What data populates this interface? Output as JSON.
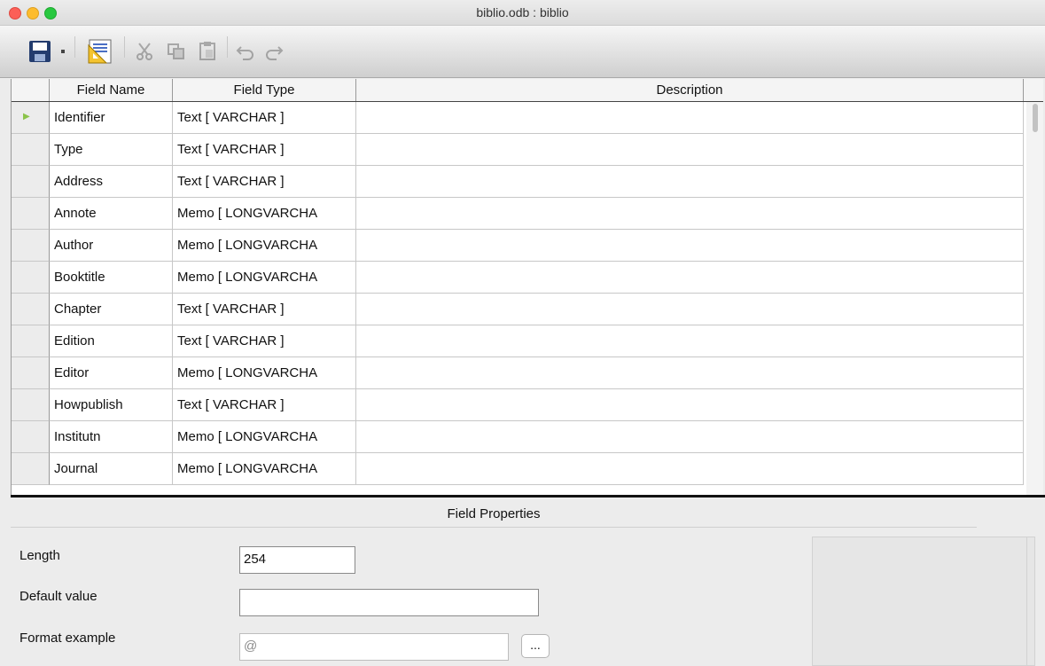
{
  "window": {
    "title": "biblio.odb : biblio"
  },
  "toolbar": {
    "buttons": [
      "save-icon",
      "dropdown-arrow-icon",
      "table-design-icon",
      "cut-icon",
      "copy-icon",
      "paste-icon",
      "undo-icon",
      "redo-icon"
    ]
  },
  "table": {
    "headers": [
      "Field Name",
      "Field Type",
      "Description"
    ],
    "rows": [
      {
        "name": "Identifier",
        "type": "Text [ VARCHAR ]",
        "description": ""
      },
      {
        "name": "Type",
        "type": "Text [ VARCHAR ]",
        "description": ""
      },
      {
        "name": "Address",
        "type": "Text [ VARCHAR ]",
        "description": ""
      },
      {
        "name": "Annote",
        "type": "Memo [ LONGVARCHA",
        "description": ""
      },
      {
        "name": "Author",
        "type": "Memo [ LONGVARCHA",
        "description": ""
      },
      {
        "name": "Booktitle",
        "type": "Memo [ LONGVARCHA",
        "description": ""
      },
      {
        "name": "Chapter",
        "type": "Text [ VARCHAR ]",
        "description": ""
      },
      {
        "name": "Edition",
        "type": "Text [ VARCHAR ]",
        "description": ""
      },
      {
        "name": "Editor",
        "type": "Memo [ LONGVARCHA",
        "description": ""
      },
      {
        "name": "Howpublish",
        "type": "Text [ VARCHAR ]",
        "description": ""
      },
      {
        "name": "Institutn",
        "type": "Memo [ LONGVARCHA",
        "description": ""
      },
      {
        "name": "Journal",
        "type": "Memo [ LONGVARCHA",
        "description": ""
      }
    ],
    "current_row_indicator": "▶"
  },
  "field_properties": {
    "title": "Field Properties",
    "length_label": "Length",
    "length_value": "254",
    "default_label": "Default value",
    "default_value": "",
    "format_label": "Format example",
    "format_value": "@",
    "format_button": "..."
  },
  "colors": {
    "row_indicator": "#8bc34a",
    "save_icon": "#233c6e"
  }
}
